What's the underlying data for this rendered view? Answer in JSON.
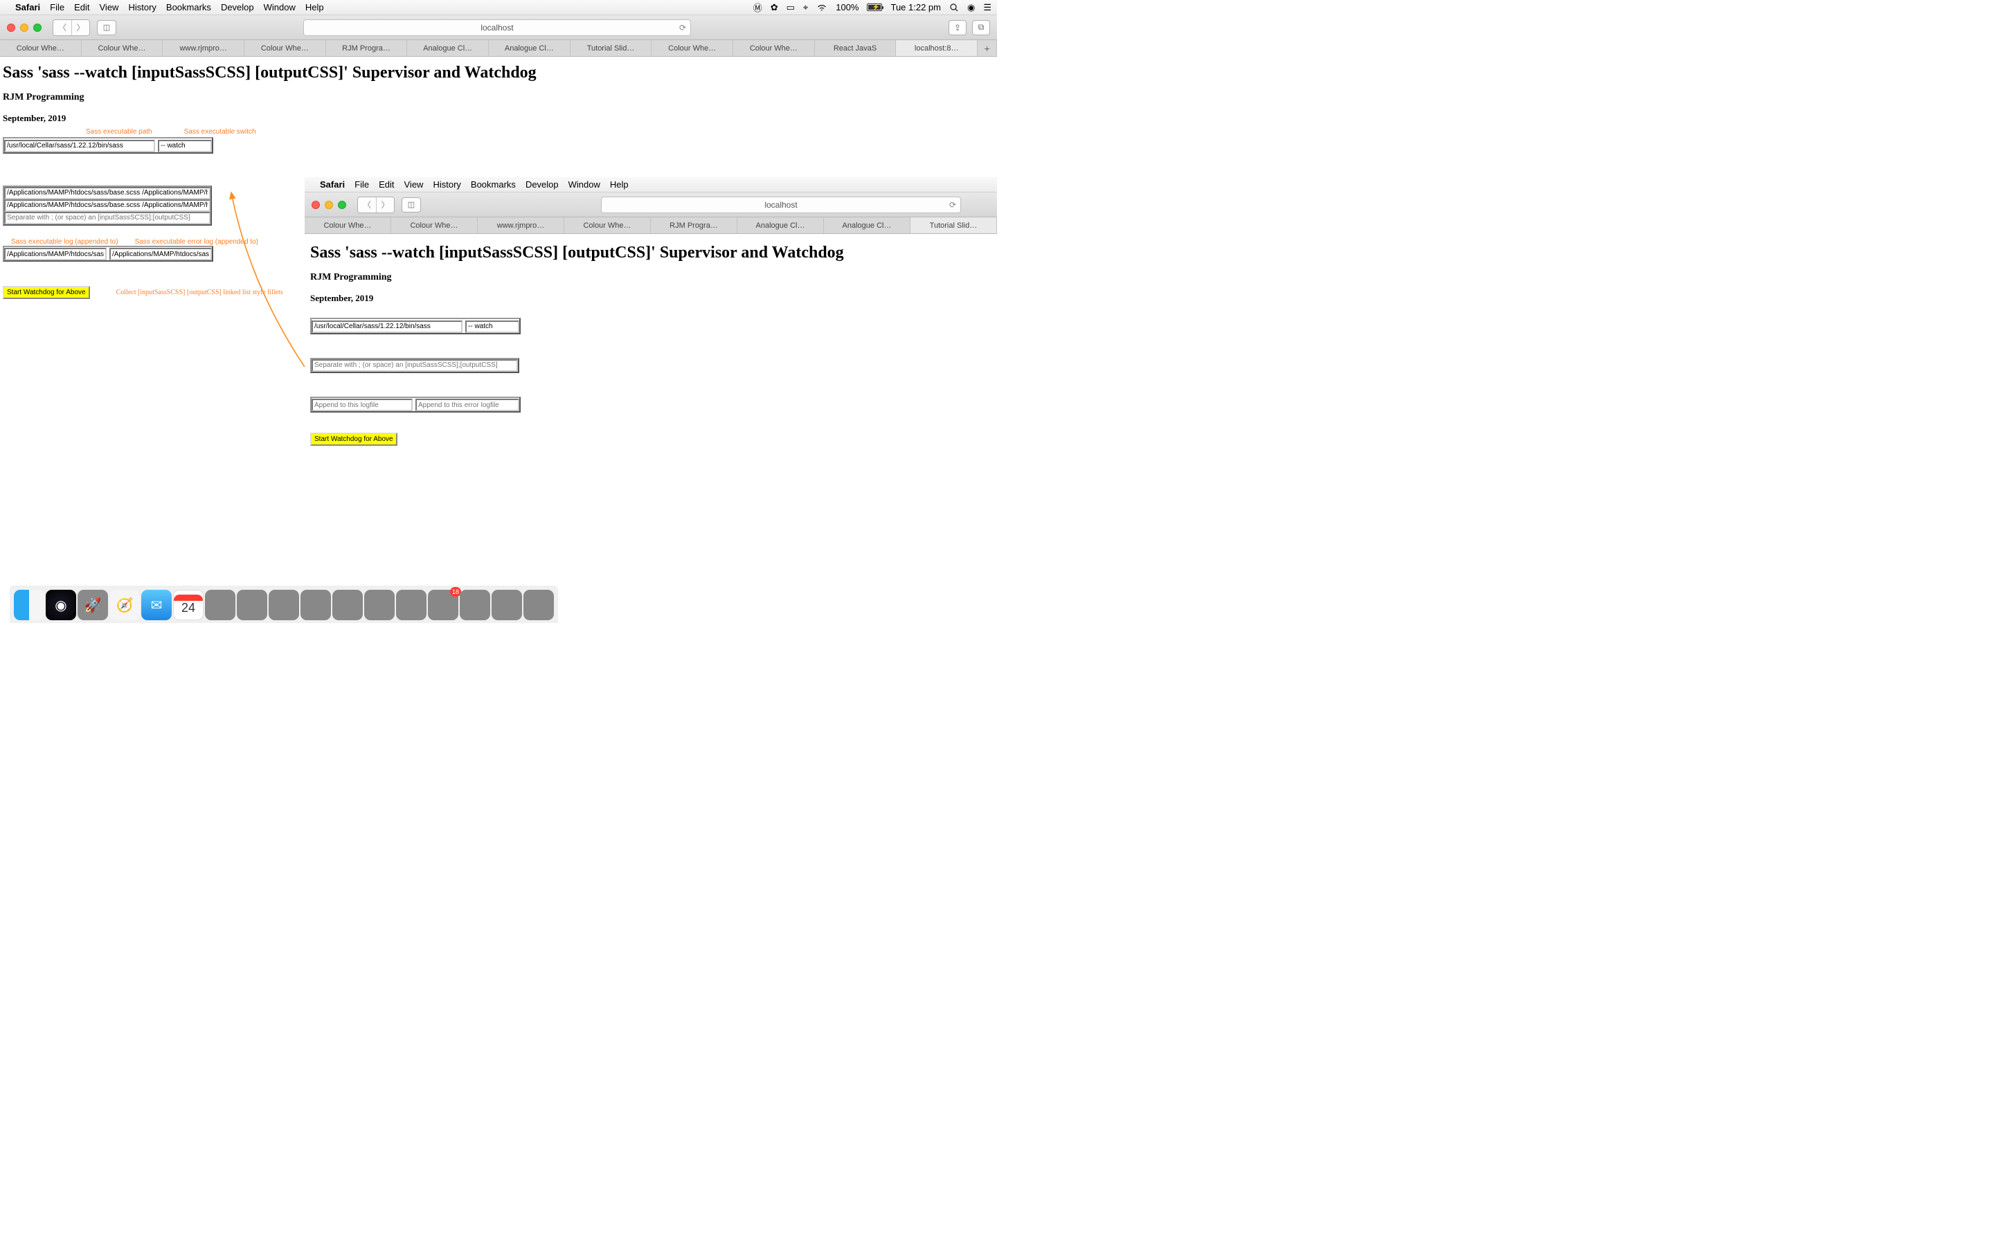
{
  "menubar": {
    "app": "Safari",
    "items": [
      "File",
      "Edit",
      "View",
      "History",
      "Bookmarks",
      "Develop",
      "Window",
      "Help"
    ],
    "battery_pct": "100%",
    "clock": "Tue 1:22 pm"
  },
  "window1": {
    "url": "localhost",
    "tabs": [
      "Colour Whe…",
      "Colour Whe…",
      "www.rjmpro…",
      "Colour Whe…",
      "RJM Progra…",
      "Analogue Cl…",
      "Analogue Cl…",
      "Tutorial Slid…",
      "Colour Whe…",
      "Colour Whe…",
      "React JavaS",
      "localhost:8…"
    ],
    "page": {
      "title": "Sass 'sass --watch [inputSassSCSS] [outputCSS]' Supervisor and Watchdog",
      "org": "RJM Programming",
      "date": "September, 2019",
      "lbl_path": "Sass executable path",
      "lbl_switch": "Sass executable switch",
      "val_path": "/usr/local/Cellar/sass/1.22.12/bin/sass",
      "val_switch": "-- watch",
      "row1": "/Applications/MAMP/htdocs/sass/base.scss /Applications/MAMP/htd",
      "row2": "/Applications/MAMP/htdocs/sass/base.scss /Applications/MAMP/htd",
      "ph_sep": "Separate with ; (or space) an [inputSassSCSS];[outputCSS]",
      "lbl_log": "Sass executable log (appended to)",
      "lbl_errlog": "Sass executable error log (appended to)",
      "val_log": "/Applications/MAMP/htdocs/sass/s",
      "val_errlog": "/Applications/MAMP/htdocs/sass/s",
      "btn": "Start Watchdog for Above",
      "link": "Collect [inputSassSCSS] [outputCSS] linked list style fillets"
    }
  },
  "window2": {
    "url": "localhost",
    "tabs": [
      "Colour Whe…",
      "Colour Whe…",
      "www.rjmpro…",
      "Colour Whe…",
      "RJM Progra…",
      "Analogue Cl…",
      "Analogue Cl…",
      "Tutorial Slid…"
    ],
    "page": {
      "title": "Sass 'sass --watch [inputSassSCSS] [outputCSS]' Supervisor and Watchdog",
      "org": "RJM Programming",
      "date": "September, 2019",
      "val_path": "/usr/local/Cellar/sass/1.22.12/bin/sass",
      "val_switch": "-- watch",
      "ph_sep": "Separate with ; (or space) an [inputSassSCSS];[outputCSS]",
      "ph_log": "Append to this logfile",
      "ph_errlog": "Append to this error logfile",
      "btn": "Start Watchdog for Above"
    }
  },
  "dock": {
    "cal_day": "24"
  }
}
